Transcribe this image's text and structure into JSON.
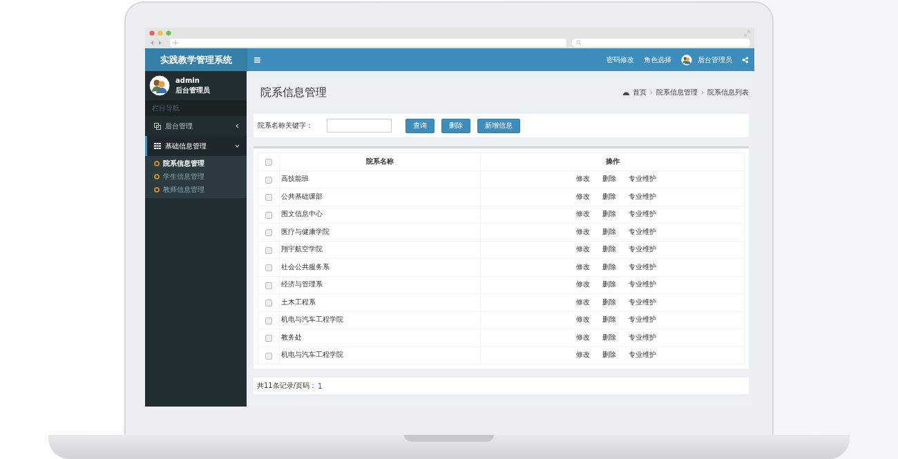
{
  "header": {
    "brand": "实践教学管理系统",
    "links": [
      "密码修改",
      "角色选择"
    ],
    "user": "后台管理员"
  },
  "sidebar": {
    "user": {
      "name": "admin",
      "role": "后台管理员"
    },
    "section_label": "栏目导航",
    "menu": [
      {
        "label": "后台管理",
        "kind": "copy",
        "expanded": false,
        "selected": false
      },
      {
        "label": "基础信息管理",
        "kind": "grid",
        "expanded": true,
        "selected": true,
        "children": [
          {
            "label": "院系信息管理",
            "selected": true
          },
          {
            "label": "学生信息管理",
            "selected": false
          },
          {
            "label": "教师信息管理",
            "selected": false
          }
        ]
      }
    ]
  },
  "page": {
    "title": "院系信息管理",
    "breadcrumb": [
      "首页",
      "院系信息管理",
      "院系信息列表"
    ]
  },
  "search": {
    "label": "院系名称关键字：",
    "buttons": [
      "查询",
      "删除",
      "新增信息"
    ]
  },
  "table": {
    "columns": [
      "院系名称",
      "操作"
    ],
    "all_checked": false,
    "rows": [
      {
        "name": "高技能班",
        "checked": false,
        "actions": [
          "修改",
          "删除",
          "专业维护"
        ]
      },
      {
        "name": "公共基础课部",
        "checked": false,
        "actions": [
          "修改",
          "删除",
          "专业维护"
        ]
      },
      {
        "name": "图文信息中心",
        "checked": false,
        "actions": [
          "修改",
          "删除",
          "专业维护"
        ]
      },
      {
        "name": "医疗与健康学院",
        "checked": false,
        "actions": [
          "修改",
          "删除",
          "专业维护"
        ]
      },
      {
        "name": "翔宇航空学院",
        "checked": false,
        "actions": [
          "修改",
          "删除",
          "专业维护"
        ]
      },
      {
        "name": "社会公共服务系",
        "checked": false,
        "actions": [
          "修改",
          "删除",
          "专业维护"
        ]
      },
      {
        "name": "经济与管理系",
        "checked": false,
        "actions": [
          "修改",
          "删除",
          "专业维护"
        ]
      },
      {
        "name": "土木工程系",
        "checked": false,
        "actions": [
          "修改",
          "删除",
          "专业维护"
        ]
      },
      {
        "name": "机电与汽车工程学院",
        "checked": false,
        "actions": [
          "修改",
          "删除",
          "专业维护"
        ]
      },
      {
        "name": "教务处",
        "checked": false,
        "actions": [
          "修改",
          "删除",
          "专业维护"
        ]
      },
      {
        "name": "机电与汽车工程学院",
        "checked": false,
        "actions": [
          "修改",
          "删除",
          "专业维护"
        ]
      }
    ]
  },
  "footer": {
    "summary": "共11条记录/页码：",
    "page": "1"
  }
}
